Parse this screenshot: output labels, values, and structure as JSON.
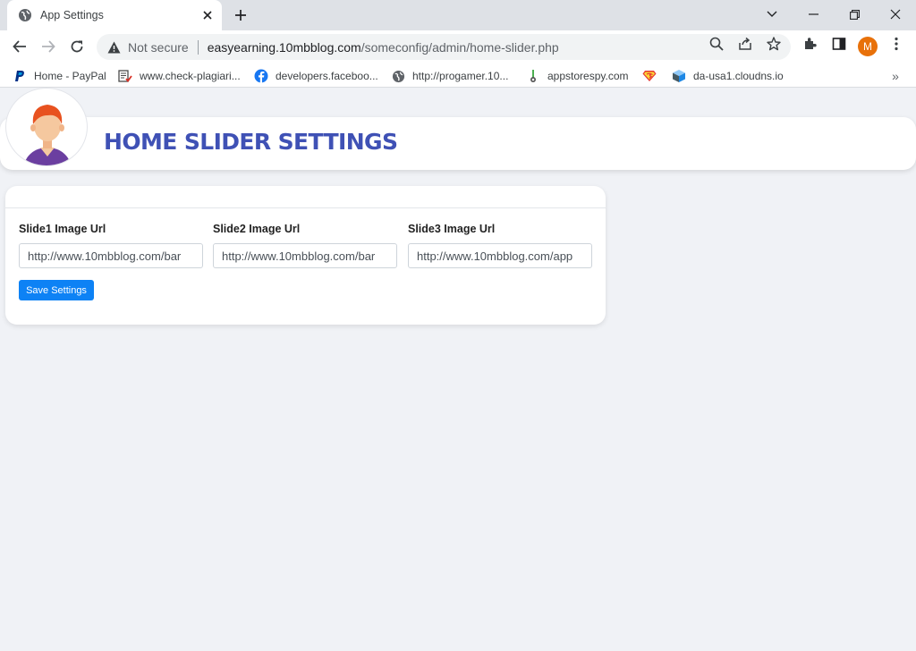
{
  "browser": {
    "tab_title": "App Settings",
    "omnibox": {
      "security_label": "Not secure",
      "url_host": "easyearning.10mbblog.com",
      "url_path": "/someconfig/admin/home-slider.php"
    },
    "profile_initial": "M",
    "profile_color": "#e8710a",
    "bookmarks": [
      {
        "label": "Home - PayPal",
        "icon": "paypal-icon"
      },
      {
        "label": "www.check-plagiari...",
        "icon": "document-icon"
      },
      {
        "label": "developers.faceboo...",
        "icon": "facebook-icon"
      },
      {
        "label": "http://progamer.10...",
        "icon": "globe-icon"
      },
      {
        "label": "appstorespy.com",
        "icon": "spy-icon"
      },
      {
        "label": "",
        "icon": "superman-icon"
      },
      {
        "label": "da-usa1.cloudns.io",
        "icon": "cube-icon"
      }
    ],
    "bookmarks_more": "»"
  },
  "page": {
    "title": "HOME SLIDER SETTINGS",
    "accent_color": "#3f51b5",
    "button_color": "#0d82f5",
    "fields": [
      {
        "label": "Slide1 Image Url",
        "value": "http://www.10mbblog.com/bar"
      },
      {
        "label": "Slide2 Image Url",
        "value": "http://www.10mbblog.com/bar"
      },
      {
        "label": "Slide3 Image Url",
        "value": "http://www.10mbblog.com/app"
      }
    ],
    "save_label": "Save Settings"
  }
}
